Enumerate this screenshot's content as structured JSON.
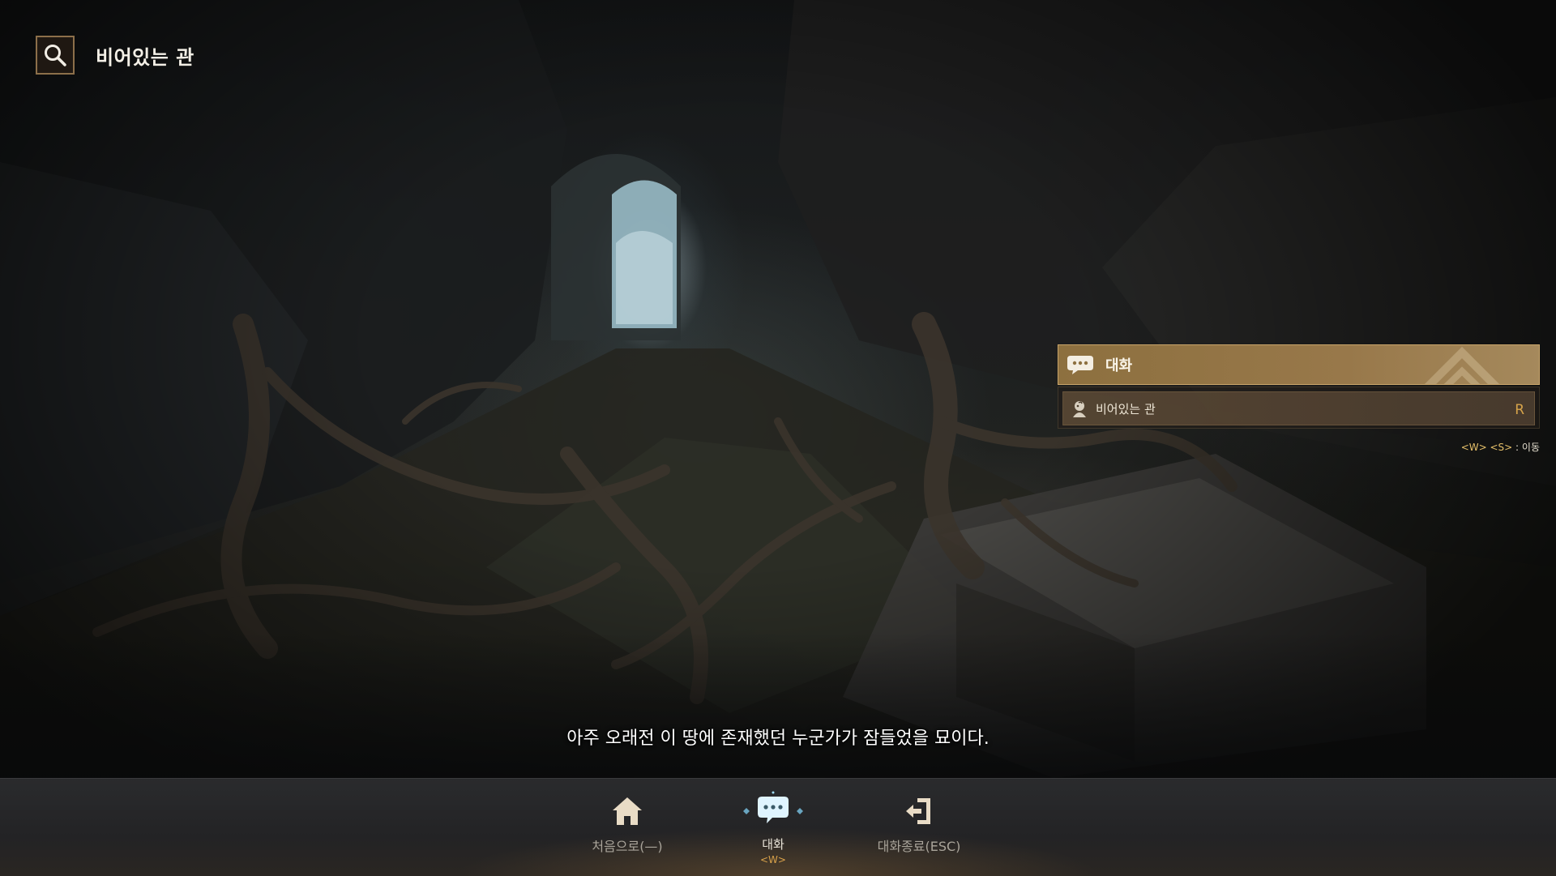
{
  "header": {
    "title": "비어있는 관"
  },
  "dialog_panel": {
    "header_label": "대화",
    "options": [
      {
        "label": "비어있는 관",
        "hotkey": "R"
      }
    ],
    "move_hint_keys": "<W> <S>",
    "move_hint_action": ": 이동"
  },
  "subtitle": "아주 오래전 이 땅에 존재했던 누군가가 잠들었을 묘이다.",
  "bottom_nav": {
    "home_label": "처음으로(—)",
    "talk_label": "대화",
    "talk_key": "<W>",
    "exit_label": "대화종료(ESC)"
  },
  "colors": {
    "accent_gold": "#98784a",
    "hotkey_gold": "#d6a34a",
    "bar_bg": "#262628",
    "talk_icon": "#dff4ff"
  },
  "icons": {
    "title": "search-icon",
    "panel_header": "chat-bubble-icon",
    "option": "npc-portrait-icon",
    "home": "home-icon",
    "talk": "chat-bubble-icon",
    "exit": "exit-door-icon"
  }
}
